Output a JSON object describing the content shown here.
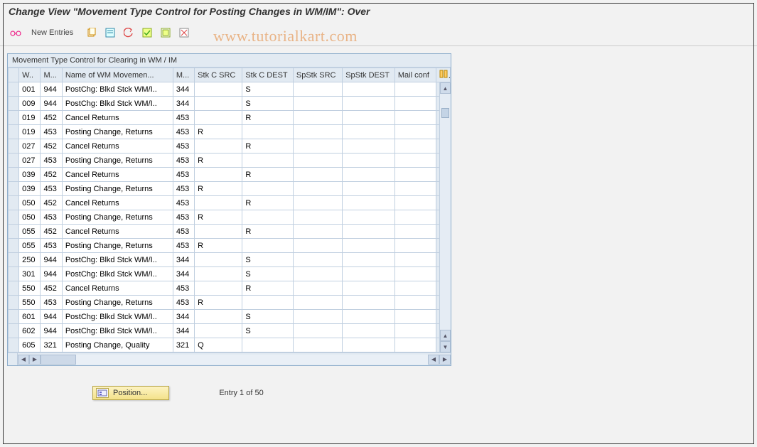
{
  "header": {
    "title": "Change View \"Movement Type Control for Posting Changes in WM/IM\": Over"
  },
  "watermark": "www.tutorialkart.com",
  "toolbar": {
    "new_entries": "New Entries"
  },
  "panel": {
    "title": "Movement Type Control for Clearing in WM / IM"
  },
  "columns": {
    "w": "W..",
    "m": "M...",
    "name": "Name of WM Movemen...",
    "m2": "M...",
    "stkcsrc": "Stk C SRC",
    "stkcdest": "Stk C DEST",
    "spstksrc": "SpStk SRC",
    "spstkdest": "SpStk DEST",
    "mail": "Mail conf"
  },
  "rows": [
    {
      "w": "001",
      "m": "944",
      "name": "PostChg: Blkd Stck WM/I..",
      "m2": "344",
      "src": "",
      "dest": "S",
      "spsrc": "",
      "spdest": "",
      "mail": ""
    },
    {
      "w": "009",
      "m": "944",
      "name": "PostChg: Blkd Stck WM/I..",
      "m2": "344",
      "src": "",
      "dest": "S",
      "spsrc": "",
      "spdest": "",
      "mail": ""
    },
    {
      "w": "019",
      "m": "452",
      "name": "Cancel Returns",
      "m2": "453",
      "src": "",
      "dest": "R",
      "spsrc": "",
      "spdest": "",
      "mail": ""
    },
    {
      "w": "019",
      "m": "453",
      "name": "Posting Change, Returns",
      "m2": "453",
      "src": "R",
      "dest": "",
      "spsrc": "",
      "spdest": "",
      "mail": ""
    },
    {
      "w": "027",
      "m": "452",
      "name": "Cancel Returns",
      "m2": "453",
      "src": "",
      "dest": "R",
      "spsrc": "",
      "spdest": "",
      "mail": ""
    },
    {
      "w": "027",
      "m": "453",
      "name": "Posting Change, Returns",
      "m2": "453",
      "src": "R",
      "dest": "",
      "spsrc": "",
      "spdest": "",
      "mail": ""
    },
    {
      "w": "039",
      "m": "452",
      "name": "Cancel Returns",
      "m2": "453",
      "src": "",
      "dest": "R",
      "spsrc": "",
      "spdest": "",
      "mail": ""
    },
    {
      "w": "039",
      "m": "453",
      "name": "Posting Change, Returns",
      "m2": "453",
      "src": "R",
      "dest": "",
      "spsrc": "",
      "spdest": "",
      "mail": ""
    },
    {
      "w": "050",
      "m": "452",
      "name": "Cancel Returns",
      "m2": "453",
      "src": "",
      "dest": "R",
      "spsrc": "",
      "spdest": "",
      "mail": ""
    },
    {
      "w": "050",
      "m": "453",
      "name": "Posting Change, Returns",
      "m2": "453",
      "src": "R",
      "dest": "",
      "spsrc": "",
      "spdest": "",
      "mail": ""
    },
    {
      "w": "055",
      "m": "452",
      "name": "Cancel Returns",
      "m2": "453",
      "src": "",
      "dest": "R",
      "spsrc": "",
      "spdest": "",
      "mail": ""
    },
    {
      "w": "055",
      "m": "453",
      "name": "Posting Change, Returns",
      "m2": "453",
      "src": "R",
      "dest": "",
      "spsrc": "",
      "spdest": "",
      "mail": ""
    },
    {
      "w": "250",
      "m": "944",
      "name": "PostChg: Blkd Stck WM/I..",
      "m2": "344",
      "src": "",
      "dest": "S",
      "spsrc": "",
      "spdest": "",
      "mail": ""
    },
    {
      "w": "301",
      "m": "944",
      "name": "PostChg: Blkd Stck WM/I..",
      "m2": "344",
      "src": "",
      "dest": "S",
      "spsrc": "",
      "spdest": "",
      "mail": ""
    },
    {
      "w": "550",
      "m": "452",
      "name": "Cancel Returns",
      "m2": "453",
      "src": "",
      "dest": "R",
      "spsrc": "",
      "spdest": "",
      "mail": ""
    },
    {
      "w": "550",
      "m": "453",
      "name": "Posting Change, Returns",
      "m2": "453",
      "src": "R",
      "dest": "",
      "spsrc": "",
      "spdest": "",
      "mail": ""
    },
    {
      "w": "601",
      "m": "944",
      "name": "PostChg: Blkd Stck WM/I..",
      "m2": "344",
      "src": "",
      "dest": "S",
      "spsrc": "",
      "spdest": "",
      "mail": ""
    },
    {
      "w": "602",
      "m": "944",
      "name": "PostChg: Blkd Stck WM/I..",
      "m2": "344",
      "src": "",
      "dest": "S",
      "spsrc": "",
      "spdest": "",
      "mail": ""
    },
    {
      "w": "605",
      "m": "321",
      "name": "Posting Change, Quality",
      "m2": "321",
      "src": "Q",
      "dest": "",
      "spsrc": "",
      "spdest": "",
      "mail": ""
    }
  ],
  "footer": {
    "position": "Position...",
    "entry": "Entry 1 of 50"
  }
}
